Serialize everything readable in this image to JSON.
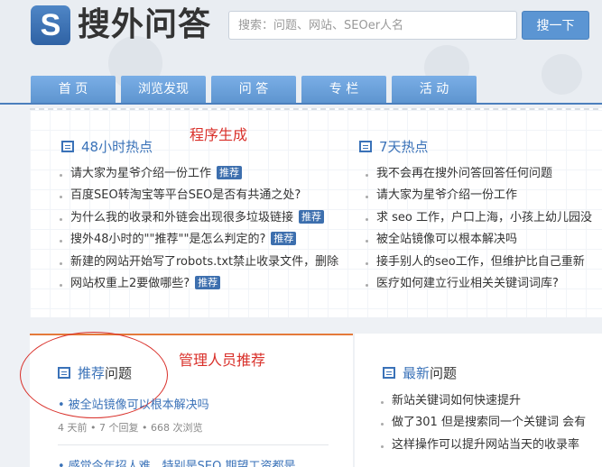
{
  "header": {
    "logo_letter": "S",
    "logo_text": "搜外问答",
    "search_placeholder": "搜索：问题、网站、SEOer人名",
    "search_button": "搜一下"
  },
  "nav": [
    "首 页",
    "浏览发现",
    "问 答",
    "专 栏",
    "活 动"
  ],
  "annotations": {
    "program": "程序生成",
    "admin": "管理人员推荐"
  },
  "hot48": {
    "title": "48小时热点",
    "items": [
      {
        "text": "请大家为星爷介绍一份工作",
        "badge": "推荐"
      },
      {
        "text": "百度SEO转淘宝等平台SEO是否有共通之处?",
        "badge": ""
      },
      {
        "text": "为什么我的收录和外链会出现很多垃圾链接",
        "badge": "推荐"
      },
      {
        "text": "搜外48小时的\"\"推荐\"\"是怎么判定的?",
        "badge": "推荐"
      },
      {
        "text": "新建的网站开始写了robots.txt禁止收录文件，删除",
        "badge": ""
      },
      {
        "text": "网站权重上2要做哪些?",
        "badge": "推荐"
      }
    ]
  },
  "hot7": {
    "title": "7天热点",
    "items": [
      "我不会再在搜外问答回答任何问题",
      "请大家为星爷介绍一份工作",
      "求 seo 工作，户口上海，小孩上幼儿园没",
      "被全站镜像可以根本解决吗",
      "接手别人的seo工作，但维护比自己重新",
      "医疗如何建立行业相关关键词词库?"
    ]
  },
  "recommended": {
    "title_highlight": "推荐",
    "title_rest": "问题",
    "q1_title": "被全站镜像可以根本解决吗",
    "q1_meta": "4 天前 • 7 个回复 • 668 次浏览",
    "q2_title": "感觉今年招人难，特别是SEO 期望工资都是"
  },
  "latest": {
    "title_highlight": "最新",
    "title_rest": "问题",
    "items": [
      "新站关键词如何快速提升",
      "做了301 但是搜索同一个关键词 会有",
      "这样操作可以提升网站当天的收录率"
    ]
  }
}
